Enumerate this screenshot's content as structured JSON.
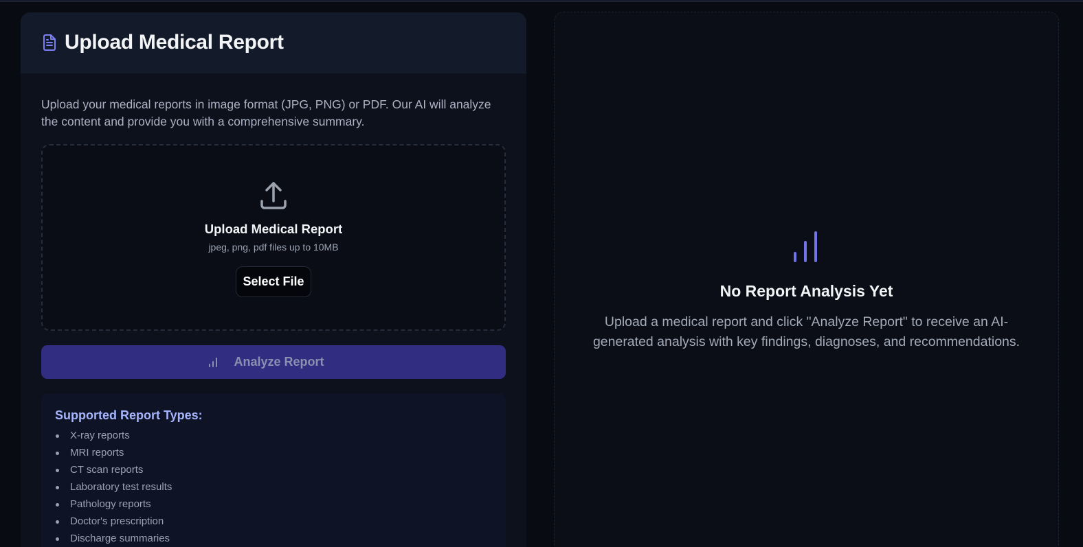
{
  "upload_panel": {
    "title": "Upload Medical Report",
    "title_icon": "document-icon",
    "intro": "Upload your medical reports in image format (JPG, PNG) or PDF. Our AI will analyze the content and provide you with a comprehensive summary.",
    "dropzone": {
      "icon": "upload-icon",
      "title": "Upload Medical Report",
      "subtitle": "jpeg, png, pdf files up to 10MB",
      "select_label": "Select File"
    },
    "analyze_label": "Analyze Report",
    "analyze_icon": "bar-chart-icon",
    "supported": {
      "title": "Supported Report Types:",
      "items": [
        "X-ray reports",
        "MRI reports",
        "CT scan reports",
        "Laboratory test results",
        "Pathology reports",
        "Doctor's prescription",
        "Discharge summaries"
      ]
    }
  },
  "analysis_panel": {
    "icon": "bar-chart-icon",
    "title": "No Report Analysis Yet",
    "text": "Upload a medical report and click \"Analyze Report\" to receive an AI-generated analysis with key findings, diagnoses, and recommendations."
  },
  "colors": {
    "background": "#090b12",
    "panel": "#0d111c",
    "accent": "#6366f1",
    "accent_dark": "#312e81",
    "heading_accent": "#a5b4fc"
  }
}
